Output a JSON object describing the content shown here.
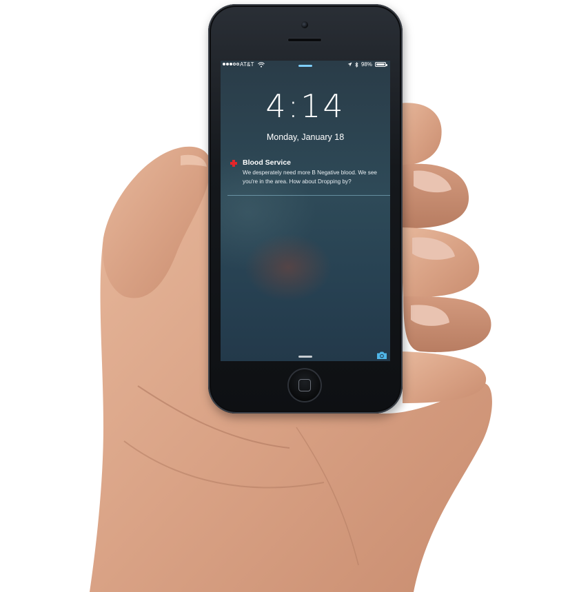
{
  "status_bar": {
    "carrier": "AT&T",
    "battery_percent_label": "98%",
    "battery_level": 0.98,
    "signal_bars_filled": 3,
    "signal_bars_total": 5
  },
  "lock_screen": {
    "time": "4:14",
    "date": "Monday, January 18"
  },
  "notification": {
    "app_name": "Blood Service",
    "message": "We desperately need more B Negative blood. We see you're in the area. How about Dropping by?",
    "icon": "red-cross-icon",
    "icon_color": "#e4252a"
  },
  "icons": {
    "wifi": "wifi-icon",
    "location": "location-arrow-icon",
    "bluetooth": "bluetooth-icon",
    "battery": "battery-icon",
    "camera": "camera-icon"
  },
  "colors": {
    "accent_blue": "#7fd0ff",
    "camera_blue": "#4fb6e8"
  }
}
